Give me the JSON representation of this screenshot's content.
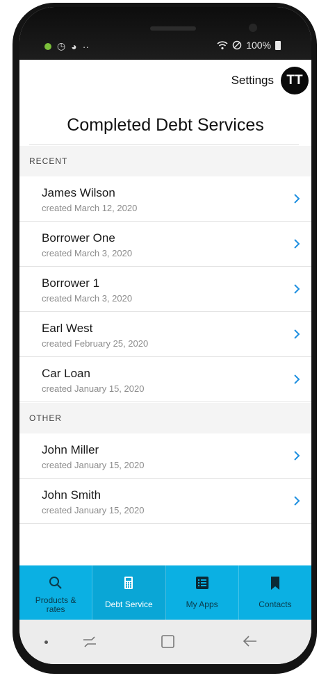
{
  "status_bar": {
    "left_icons": [
      "android-icon",
      "alarm-icon",
      "sync-icon"
    ],
    "left_dots": "··",
    "battery": "100%"
  },
  "header": {
    "settings_label": "Settings",
    "avatar_initials": "TT",
    "page_title": "Completed Debt Services"
  },
  "sections": [
    {
      "title": "RECENT",
      "items": [
        {
          "name": "James Wilson",
          "created": "created March 12, 2020"
        },
        {
          "name": "Borrower One",
          "created": "created March 3, 2020"
        },
        {
          "name": "Borrower 1",
          "created": "created March 3, 2020"
        },
        {
          "name": "Earl West",
          "created": "created February 25, 2020"
        },
        {
          "name": "Car Loan",
          "created": "created January 15, 2020"
        }
      ]
    },
    {
      "title": "OTHER",
      "items": [
        {
          "name": "John Miller",
          "created": "created January 15, 2020"
        },
        {
          "name": "John Smith",
          "created": "created January 15, 2020"
        }
      ]
    }
  ],
  "tabs": [
    {
      "label": "Products & rates",
      "icon": "search-icon"
    },
    {
      "label": "Debt Service",
      "icon": "calculator-icon",
      "active": true
    },
    {
      "label": "My Apps",
      "icon": "list-icon"
    },
    {
      "label": "Contacts",
      "icon": "bookmark-icon"
    }
  ],
  "colors": {
    "accent": "#0bb0e3",
    "chevron": "#1e8fe0",
    "section_bg": "#f4f4f4"
  }
}
